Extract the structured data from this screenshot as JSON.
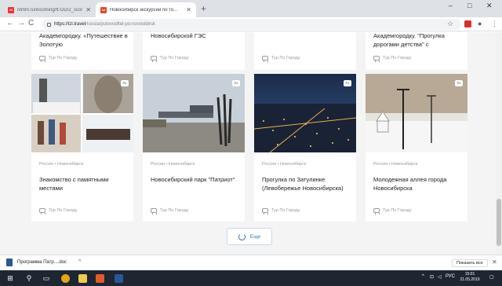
{
  "browser": {
    "tabs": [
      {
        "title": "ntmm.ru/incoming/ft-OD/2_scon",
        "favicon": "mail-favicon",
        "active": false
      },
      {
        "title": "Новосибирск экскурсии по то...",
        "favicon": "travel-favicon",
        "active": true
      }
    ],
    "address": {
      "host": "https://izi.travel",
      "path": "/russia/putevoditel-po-novosibirsk"
    },
    "window_controls": {
      "minimize": "–",
      "maximize": "□",
      "close": "✕"
    }
  },
  "top_cards": [
    {
      "title": "Академгородку. «Путешествие в Золотую",
      "tag": "Тур По Городу"
    },
    {
      "title": "Новосибирской ГЭС",
      "tag": "Тур По Городу"
    },
    {
      "title": "",
      "tag": "Тур По Городу"
    },
    {
      "title": "Академгородку. \"Прогулка дорогами детства\" с",
      "tag": "Тур По Городу"
    }
  ],
  "cards": [
    {
      "lang": "ru",
      "country": "Россия",
      "city": "Новосибирск",
      "title": "Знакомство с памятными местами",
      "tag": "Тур По Городу"
    },
    {
      "lang": "ru",
      "country": "Россия",
      "city": "Новосибирск",
      "title": "Новосибирский парк \"Патриот\"",
      "tag": "Тур По Городу"
    },
    {
      "lang": "ru",
      "country": "Россия",
      "city": "Новосибирск",
      "title": "Прогулка по Затулинке (Левобережье Новосибирска)",
      "tag": "Тур По Городу"
    },
    {
      "lang": "ru",
      "country": "Россия",
      "city": "Новосибирск",
      "title": "Молодежная аллея города Новосибирска",
      "tag": "Тур По Городу"
    }
  ],
  "crumb_separator": "•",
  "load_more": {
    "label": "Еще"
  },
  "downloads": {
    "file": "Программа Патр....doc",
    "show_all": "Показать все"
  },
  "taskbar": {
    "lang": "РУС",
    "time": "15:01",
    "date": "21.05.2019"
  },
  "colors": {
    "accent": "#3a6fc4",
    "taskbar": "#1d2631",
    "page_bg": "#f4f4f4"
  }
}
